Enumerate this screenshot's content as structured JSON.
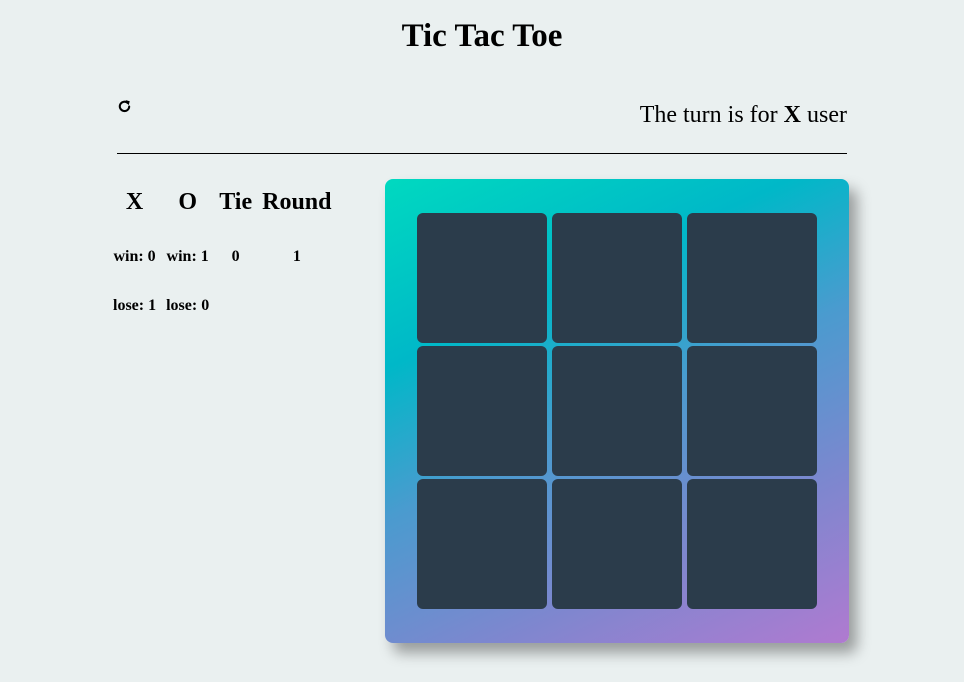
{
  "header": {
    "title": "Tic Tac Toe"
  },
  "turn": {
    "prefix": "The turn is for",
    "player": "X",
    "suffix": "user"
  },
  "reset": {
    "icon": "refresh-icon"
  },
  "scoreboard": {
    "headers": [
      "X",
      "O",
      "Tie",
      "Round"
    ],
    "x": {
      "win": "win: 0",
      "lose": "lose: 1"
    },
    "o": {
      "win": "win: 1",
      "lose": "lose: 0"
    },
    "tie": "0",
    "round": "1"
  },
  "board": {
    "cells": [
      "",
      "",
      "",
      "",
      "",
      "",
      "",
      "",
      ""
    ],
    "gradient_colors": [
      "#00d9c0",
      "#00b8c8",
      "#4a9bcf",
      "#7d87cf",
      "#b07ad0"
    ],
    "cell_color": "#2b3c4b"
  }
}
